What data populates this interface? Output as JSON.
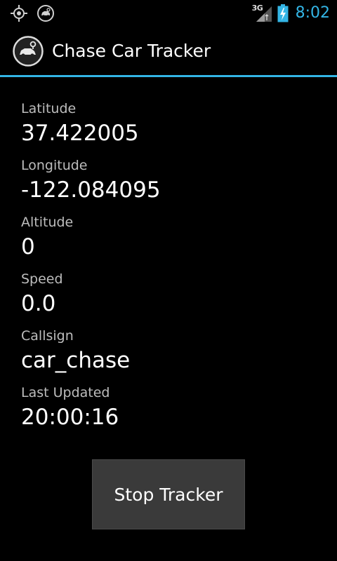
{
  "status_bar": {
    "left_icons": [
      "gps-icon",
      "car-tracker-notification-icon"
    ],
    "network_label": "3G",
    "battery_icon": "battery-charging-icon",
    "time": "8:02",
    "accent_color": "#33b5e5"
  },
  "action_bar": {
    "app_icon": "car-tracker-app-icon",
    "title": "Chase Car Tracker"
  },
  "fields": [
    {
      "label": "Latitude",
      "value": "37.422005"
    },
    {
      "label": "Longitude",
      "value": "-122.084095"
    },
    {
      "label": "Altitude",
      "value": "0"
    },
    {
      "label": "Speed",
      "value": "0.0"
    },
    {
      "label": "Callsign",
      "value": "car_chase"
    },
    {
      "label": "Last Updated",
      "value": "20:00:16"
    }
  ],
  "stop_button_label": "Stop Tracker"
}
